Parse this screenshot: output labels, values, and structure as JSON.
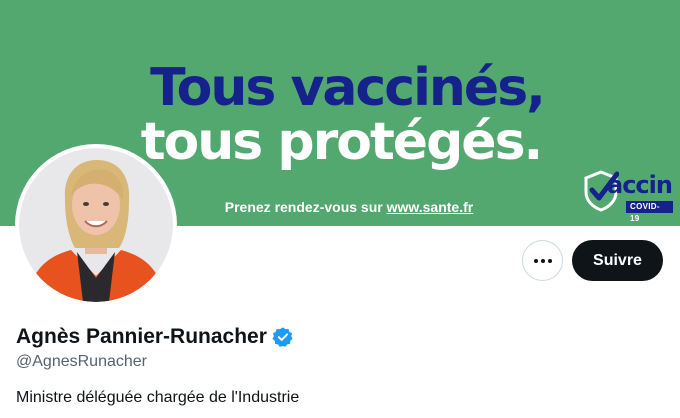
{
  "banner": {
    "headline_line1": "Tous vaccinés,",
    "headline_line2": "tous protégés.",
    "cta_prefix": "Prenez rendez-vous sur ",
    "cta_site": "www.sante.fr",
    "logo_word": "accin",
    "logo_badge": "COVID-19",
    "colors": {
      "background": "#52a86f",
      "navy": "#16228c",
      "white": "#ffffff"
    }
  },
  "avatar": {
    "icon": "profile-photo"
  },
  "actions": {
    "more_icon": "more-horizontal-icon",
    "follow_label": "Suivre"
  },
  "profile": {
    "name": "Agnès Pannier-Runacher",
    "verified_icon": "verified-badge-icon",
    "handle": "@AgnesRunacher",
    "bio": "Ministre déléguée chargée de l'Industrie"
  }
}
